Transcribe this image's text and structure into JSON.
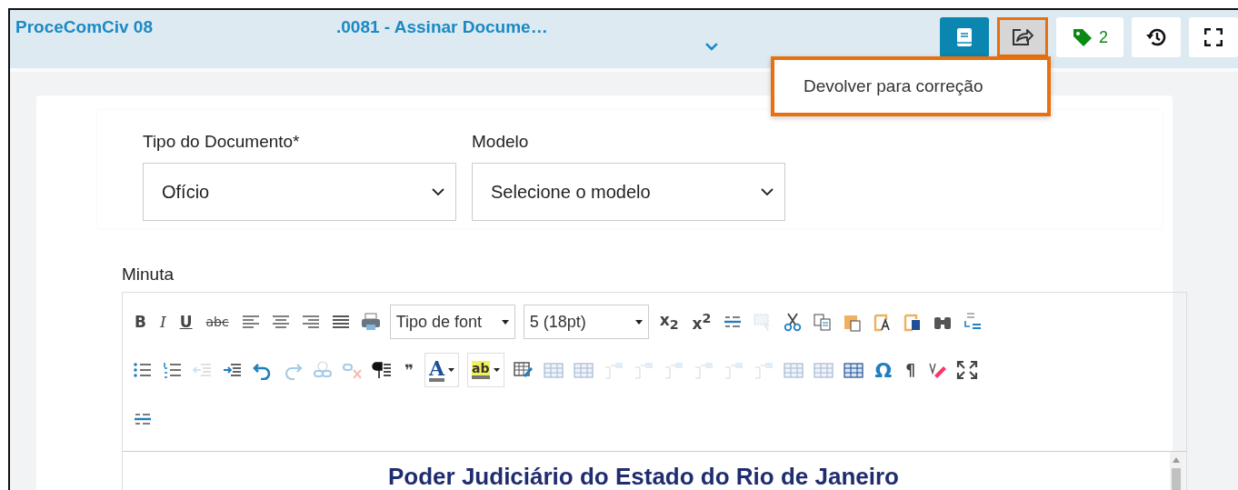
{
  "header": {
    "title_parts": [
      "ProceComCiv 08",
      ".0081 - Assinar Docume…"
    ],
    "buttons": [
      {
        "kind": "book",
        "selected": true,
        "highlighted": false
      },
      {
        "kind": "share",
        "selected": false,
        "highlighted": true
      },
      {
        "kind": "tag",
        "selected": false,
        "highlighted": false,
        "count": "2"
      },
      {
        "kind": "history",
        "selected": false,
        "highlighted": false
      },
      {
        "kind": "fullscreen",
        "selected": false,
        "highlighted": false
      }
    ],
    "menu": {
      "items": [
        {
          "label": "Devolver para correção"
        }
      ],
      "highlighted": true
    }
  },
  "form": {
    "fields": [
      {
        "label": "Tipo do Documento*",
        "value": "Ofício"
      },
      {
        "label": "Modelo",
        "value": "Selecione o modelo"
      }
    ]
  },
  "editor": {
    "label": "Minuta",
    "toolbar_rows": [
      [
        {
          "kind": "text",
          "label": "B",
          "disabled": false
        },
        {
          "kind": "text",
          "label": "I",
          "disabled": false
        },
        {
          "kind": "text",
          "label": "U",
          "disabled": false
        },
        {
          "kind": "text",
          "label": "abc",
          "disabled": false
        },
        {
          "kind": "icon",
          "disabled": false
        },
        {
          "kind": "icon",
          "disabled": false
        },
        {
          "kind": "icon",
          "disabled": false
        },
        {
          "kind": "icon",
          "disabled": false
        },
        {
          "kind": "icon",
          "disabled": false
        },
        {
          "kind": "select",
          "label": "Tipo de font"
        },
        {
          "kind": "select",
          "label": "5 (18pt)"
        },
        {
          "kind": "text",
          "label": "x$_{2}$",
          "disabled": false
        },
        {
          "kind": "text",
          "label": "x$^{2}$",
          "disabled": false
        },
        {
          "kind": "icon",
          "disabled": false
        },
        {
          "kind": "icon",
          "disabled": true
        },
        {
          "kind": "icon",
          "disabled": false
        },
        {
          "kind": "icon",
          "disabled": false
        },
        {
          "kind": "icon",
          "disabled": false
        },
        {
          "kind": "icon",
          "disabled": false
        },
        {
          "kind": "icon",
          "disabled": false
        },
        {
          "kind": "icon",
          "disabled": false
        },
        {
          "kind": "icon",
          "disabled": false
        }
      ],
      [
        {
          "kind": "icon",
          "disabled": false
        },
        {
          "kind": "icon",
          "disabled": false
        },
        {
          "kind": "icon",
          "disabled": true
        },
        {
          "kind": "icon",
          "disabled": false
        },
        {
          "kind": "icon",
          "disabled": false
        },
        {
          "kind": "icon",
          "disabled": true
        },
        {
          "kind": "icon",
          "disabled": true
        },
        {
          "kind": "icon",
          "disabled": true
        },
        {
          "kind": "icon",
          "disabled": false
        },
        {
          "kind": "text",
          "label": "❞",
          "disabled": false
        },
        {
          "kind": "color",
          "label": "A",
          "disabled": false
        },
        {
          "kind": "color",
          "label": "ab",
          "disabled": false
        },
        {
          "kind": "icon",
          "disabled": false
        },
        {
          "kind": "icon",
          "disabled": true
        },
        {
          "kind": "icon",
          "disabled": true
        },
        {
          "kind": "icon",
          "disabled": true
        },
        {
          "kind": "icon",
          "disabled": true
        },
        {
          "kind": "icon",
          "disabled": true
        },
        {
          "kind": "icon",
          "disabled": true
        },
        {
          "kind": "icon",
          "disabled": true
        },
        {
          "kind": "icon",
          "disabled": true
        },
        {
          "kind": "icon",
          "disabled": true
        },
        {
          "kind": "icon",
          "disabled": true
        },
        {
          "kind": "icon",
          "disabled": false
        },
        {
          "kind": "text",
          "label": "Ω",
          "disabled": false
        },
        {
          "kind": "text",
          "label": "¶",
          "disabled": false
        },
        {
          "kind": "icon",
          "disabled": false
        },
        {
          "kind": "icon",
          "disabled": false
        }
      ],
      [
        {
          "kind": "icon",
          "disabled": false
        }
      ]
    ],
    "document": {
      "heading": "Poder Judiciário do Estado do Rio de Janeiro"
    }
  }
}
